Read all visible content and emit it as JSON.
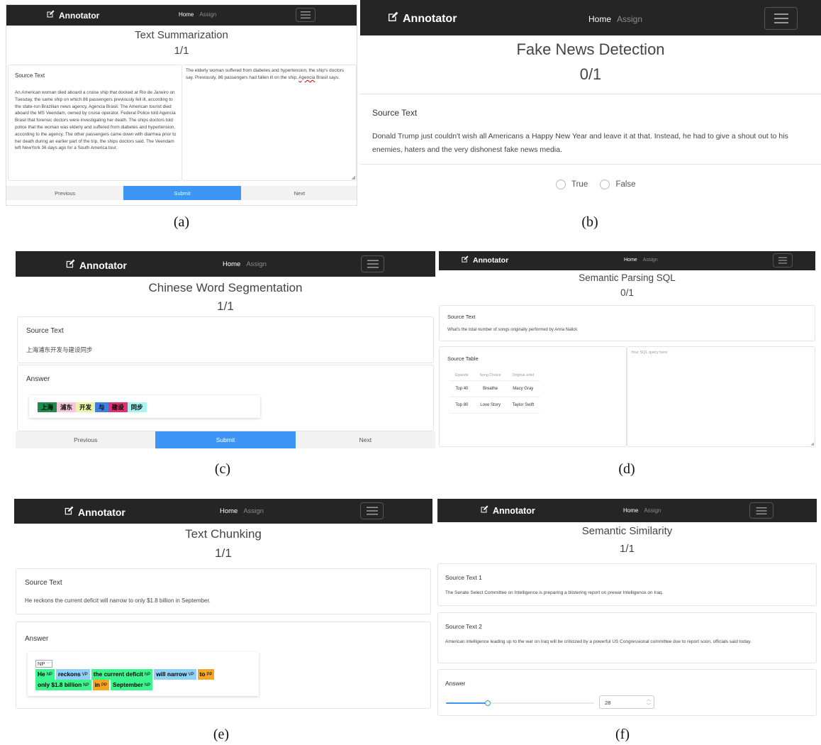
{
  "app": {
    "brand": "Annotator",
    "nav_home": "Home",
    "nav_assign": "Assign"
  },
  "common": {
    "previous": "Previous",
    "submit": "Submit",
    "next": "Next",
    "source_text": "Source Text",
    "answer": "Answer"
  },
  "captions": {
    "a": "(a)",
    "b": "(b)",
    "c": "(c)",
    "d": "(d)",
    "e": "(e)",
    "f": "(f)"
  },
  "panel_a": {
    "title": "Text Summarization",
    "progress": "1/1",
    "source_text": "An American woman died aboard a cruise ship that docked at Rio de Janeiro on Tuesday, the same ship on which 86 passengers previously fell ill, according to the state-run Brazilian news agency, Agencia Brasil. The American tourist died aboard the MS Veendam, owned by cruise operator. Federal Police told Agencia Brasil that forensic doctors were investigating her death. The ships doctors told police that the woman was elderly and suffered from diabetes and hypertension, according to the agency. The other passengers came down with diarrhea prior to her death during an earlier part of the trip, the ships doctors said. The Veendam left NewYork 36 days ago for a South America tour.",
    "summary_before": "The elderly woman suffered from diabetes and hypertension, the ship's doctors say. Previously, 86 passengers had fallen ill on the ship, ",
    "summary_misspelled": "Agencia",
    "summary_after": " Brasil says."
  },
  "panel_b": {
    "title": "Fake News Detection",
    "progress": "0/1",
    "source_text": "Donald Trump just couldn't wish all Americans a Happy New Year and leave it at that. Instead, he had to give a shout out to his enemies, haters and the very dishonest fake news media.",
    "options": [
      "True",
      "False"
    ]
  },
  "panel_c": {
    "title": "Chinese Word Segmentation",
    "progress": "1/1",
    "source_text": "上海浦东开发与建设同步",
    "segments": [
      {
        "text": "上海",
        "color": "#1f8a4c"
      },
      {
        "text": "浦东",
        "color": "#f7c6d9"
      },
      {
        "text": "开发",
        "color": "#e9f5a6"
      },
      {
        "text": "与",
        "color": "#3f7fe0"
      },
      {
        "text": "建设",
        "color": "#e0326f"
      },
      {
        "text": "同步",
        "color": "#a7f3ef"
      }
    ]
  },
  "panel_d": {
    "title": "Semantic Parsing SQL",
    "progress": "0/1",
    "source_text": "What's the total number of songs originally performed by Anna Nalick",
    "source_table_title": "Source Table",
    "table_headers": [
      "Episode",
      "Song Choice",
      "Original artist"
    ],
    "table_rows": [
      [
        "Top 40",
        "Breathe",
        "Macy Gray"
      ],
      [
        "Top 80",
        "Love Story",
        "Taylor Swift"
      ]
    ],
    "sql_placeholder": "Your SQL query here"
  },
  "panel_e": {
    "title": "Text Chunking",
    "progress": "1/1",
    "source_text": "He reckons the current deficit will narrow to only $1.8 billion in September.",
    "select_value": "NP",
    "chunks": [
      {
        "text": "He",
        "label": "NP",
        "color": "#3cf58f"
      },
      {
        "text": "reckons",
        "label": "VP",
        "color": "#8fd0f7"
      },
      {
        "text": "the current deficit",
        "label": "NP",
        "color": "#3cf58f"
      },
      {
        "text": "will narrow",
        "label": "VP",
        "color": "#8fd0f7"
      },
      {
        "text": "to",
        "label": "PP",
        "color": "#f5a623"
      },
      {
        "text": "only $1.8 billion",
        "label": "NP",
        "color": "#3cf58f"
      },
      {
        "text": "in",
        "label": "PP",
        "color": "#f5a623"
      },
      {
        "text": "September",
        "label": "NP",
        "color": "#3cf58f"
      }
    ]
  },
  "panel_f": {
    "title": "Semantic Similarity",
    "progress": "1/1",
    "source_text_1_title": "Source Text 1",
    "source_text_1": "The Senate Select Committee on Intelligence is preparing a blistering report on prewar Intelligence on Iraq.",
    "source_text_2_title": "Source Text 2",
    "source_text_2": "American intelligence leading up to the war on Iraq will be criticized by a powerful US Congressional committee due to report soon, officials said today.",
    "slider_value": 28,
    "slider_fraction": 0.28
  }
}
